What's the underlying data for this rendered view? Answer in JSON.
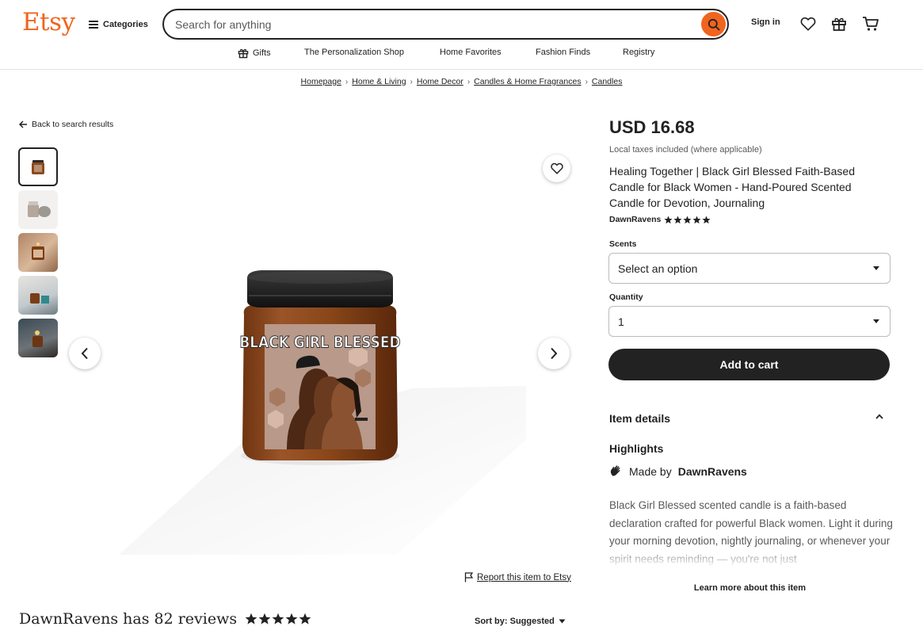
{
  "header": {
    "logo": "Etsy",
    "categories_label": "Categories",
    "search_placeholder": "Search for anything",
    "signin_label": "Sign in"
  },
  "nav": {
    "items": [
      {
        "label": "Gifts",
        "icon": "gift-icon"
      },
      {
        "label": "The Personalization Shop"
      },
      {
        "label": "Home Favorites"
      },
      {
        "label": "Fashion Finds"
      },
      {
        "label": "Registry"
      }
    ]
  },
  "breadcrumb": [
    "Homepage",
    "Home & Living",
    "Home Decor",
    "Candles & Home Fragrances",
    "Candles"
  ],
  "back_label": "Back to search results",
  "product": {
    "image_label_text": "BLACK GIRL BLESSED",
    "price": "USD 16.68",
    "tax_note": "Local taxes included (where applicable)",
    "title": "Healing Together | Black Girl Blessed Faith-Based Candle for Black Women - Hand-Poured Scented Candle for Devotion, Journaling",
    "seller": "DawnRavens",
    "seller_rating": 5,
    "scents_label": "Scents",
    "scents_value": "Select an option",
    "quantity_label": "Quantity",
    "quantity_value": "1",
    "add_to_cart": "Add to cart",
    "item_details": "Item details",
    "highlights": "Highlights",
    "made_by_prefix": "Made by",
    "made_by_name": "DawnRavens",
    "description": "Black Girl Blessed scented candle is a faith-based declaration crafted for powerful Black women. Light it during your morning devotion, nightly journaling, or whenever your spirit needs reminding — you're not just",
    "learn_more": "Learn more about this item"
  },
  "report_label": "Report this item to Etsy",
  "reviews": {
    "title": "DawnRavens has 82 reviews",
    "rating": 5,
    "sort_label": "Sort by: Suggested"
  },
  "colors": {
    "brand": "#f1641e",
    "text": "#222222",
    "button_dark": "#222222"
  }
}
